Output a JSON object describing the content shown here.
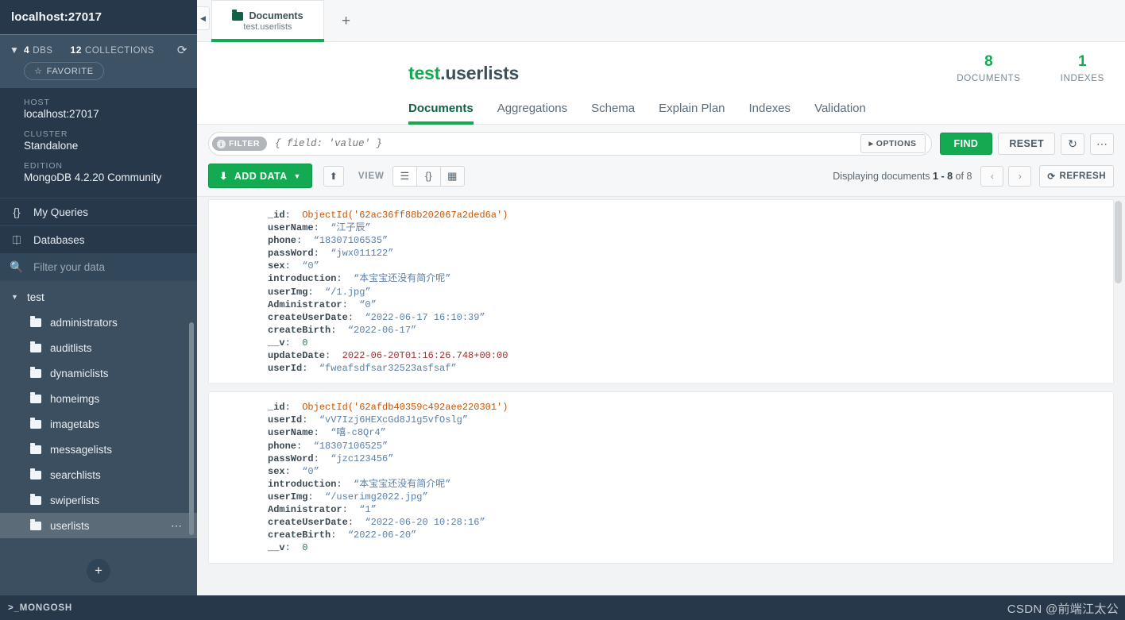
{
  "sidebar": {
    "connection_title": "localhost:27017",
    "stats": {
      "dbs_count": "4",
      "dbs_label": "DBS",
      "collections_count": "12",
      "collections_label": "COLLECTIONS",
      "refresh_icon": "refresh-icon"
    },
    "favorite_label": "FAVORITE",
    "info": [
      {
        "label": "HOST",
        "value": "localhost:27017"
      },
      {
        "label": "CLUSTER",
        "value": "Standalone"
      },
      {
        "label": "EDITION",
        "value": "MongoDB 4.2.20 Community"
      }
    ],
    "nav": [
      {
        "label": "My Queries",
        "icon": "braces-icon"
      },
      {
        "label": "Databases",
        "icon": "database-icon"
      }
    ],
    "filter": {
      "placeholder": "Filter your data",
      "value": "",
      "icon": "search-icon"
    },
    "database": {
      "name": "test",
      "expanded": true
    },
    "collections": [
      {
        "name": "administrators",
        "active": false
      },
      {
        "name": "auditlists",
        "active": false
      },
      {
        "name": "dynamiclists",
        "active": false
      },
      {
        "name": "homeimgs",
        "active": false
      },
      {
        "name": "imagetabs",
        "active": false
      },
      {
        "name": "messagelists",
        "active": false
      },
      {
        "name": "searchlists",
        "active": false
      },
      {
        "name": "swiperlists",
        "active": false
      },
      {
        "name": "userlists",
        "active": true
      }
    ],
    "add_button_label": "+",
    "mongosh_label": ">_MONGOSH"
  },
  "window_tab": {
    "title": "Documents",
    "subtitle": "test.userlists",
    "new_tab_label": "+"
  },
  "header": {
    "db_name": "test",
    "separator": ".",
    "collection_name": "userlists",
    "counts": [
      {
        "value": "8",
        "label": "DOCUMENTS"
      },
      {
        "value": "1",
        "label": "INDEXES"
      }
    ]
  },
  "tabs": [
    {
      "label": "Documents",
      "active": true
    },
    {
      "label": "Aggregations",
      "active": false
    },
    {
      "label": "Schema",
      "active": false
    },
    {
      "label": "Explain Plan",
      "active": false
    },
    {
      "label": "Indexes",
      "active": false
    },
    {
      "label": "Validation",
      "active": false
    }
  ],
  "query_bar": {
    "filter_pill": "FILTER",
    "filter_placeholder": "{ field: 'value' }",
    "filter_value": "",
    "options_label": "OPTIONS",
    "find_label": "FIND",
    "reset_label": "RESET",
    "history_icon": "history-icon",
    "more_icon": "ellipsis-icon"
  },
  "toolbar": {
    "add_data_label": "ADD DATA",
    "add_data_icon": "download-icon",
    "export_icon": "upload-icon",
    "view_label": "VIEW",
    "view_modes": [
      {
        "icon": "list-icon",
        "active": true
      },
      {
        "icon": "braces-icon",
        "active": false
      },
      {
        "icon": "table-icon",
        "active": false
      }
    ],
    "displaying_prefix": "Displaying documents",
    "displaying_range": "1 - 8",
    "displaying_of": "of 8",
    "prev_icon": "chevron-left-icon",
    "next_icon": "chevron-right-icon",
    "refresh_label": "REFRESH",
    "refresh_icon": "refresh-icon"
  },
  "documents": [
    {
      "fields": [
        {
          "key": "_id",
          "value": "ObjectId('62ac36ff88b202067a2ded6a')",
          "type": "oid"
        },
        {
          "key": "userName",
          "value": "“江子辰”",
          "type": "str"
        },
        {
          "key": "phone",
          "value": "“18307106535”",
          "type": "str"
        },
        {
          "key": "passWord",
          "value": "“jwx011122”",
          "type": "str"
        },
        {
          "key": "sex",
          "value": "“0”",
          "type": "str"
        },
        {
          "key": "introduction",
          "value": "“本宝宝还没有简介呢”",
          "type": "str"
        },
        {
          "key": "userImg",
          "value": "“/1.jpg”",
          "type": "str"
        },
        {
          "key": "Administrator",
          "value": "“0”",
          "type": "str"
        },
        {
          "key": "createUserDate",
          "value": "“2022-06-17 16:10:39”",
          "type": "str"
        },
        {
          "key": "createBirth",
          "value": "“2022-06-17”",
          "type": "str"
        },
        {
          "key": "__v",
          "value": "0",
          "type": "num"
        },
        {
          "key": "updateDate",
          "value": "2022-06-20T01:16:26.748+00:00",
          "type": "date"
        },
        {
          "key": "userId",
          "value": "“fweafsdfsar32523asfsaf”",
          "type": "str"
        }
      ]
    },
    {
      "fields": [
        {
          "key": "_id",
          "value": "ObjectId('62afdb40359c492aee220301')",
          "type": "oid"
        },
        {
          "key": "userId",
          "value": "“vV7Izj6HEXcGd8J1g5vfOslg”",
          "type": "str"
        },
        {
          "key": "userName",
          "value": "“嘻-c8Qr4”",
          "type": "str"
        },
        {
          "key": "phone",
          "value": "“18307106525”",
          "type": "str"
        },
        {
          "key": "passWord",
          "value": "“jzc123456”",
          "type": "str"
        },
        {
          "key": "sex",
          "value": "“0”",
          "type": "str"
        },
        {
          "key": "introduction",
          "value": "“本宝宝还没有简介呢”",
          "type": "str"
        },
        {
          "key": "userImg",
          "value": "“/userimg2022.jpg”",
          "type": "str"
        },
        {
          "key": "Administrator",
          "value": "“1”",
          "type": "str"
        },
        {
          "key": "createUserDate",
          "value": "“2022-06-20 10:28:16”",
          "type": "str"
        },
        {
          "key": "createBirth",
          "value": "“2022-06-20”",
          "type": "str"
        },
        {
          "key": "__v",
          "value": "0",
          "type": "num"
        }
      ]
    }
  ],
  "watermark": "CSDN @前端江太公",
  "colors": {
    "brand_green": "#13aa52",
    "dark_green": "#116149",
    "sidebar_dark": "#26384a",
    "sidebar_mid": "#3b4f60",
    "active_row": "#5b6b77"
  }
}
